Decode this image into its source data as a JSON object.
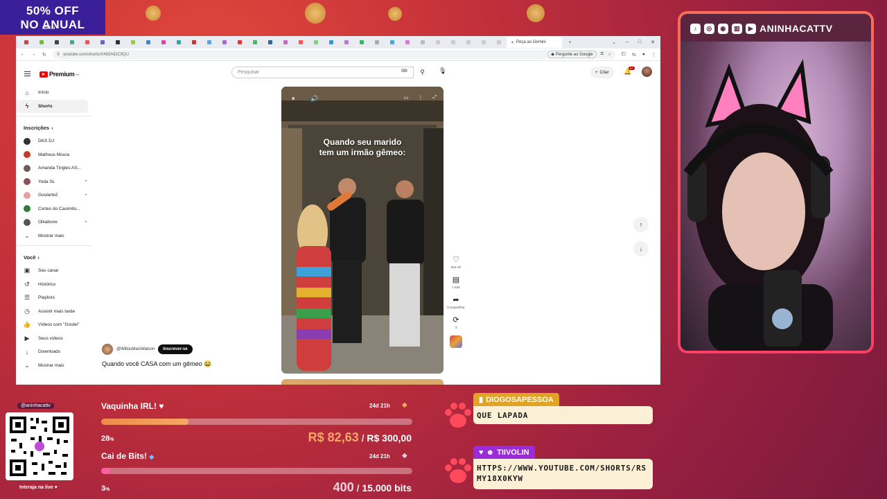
{
  "promo": {
    "line1": "50% OFF",
    "line2": "NO ANUAL",
    "line3": "EDIT.AI"
  },
  "browser": {
    "active_tab": "Peça ao Gemini",
    "url": "youtube.com/shorts/X4b5AtDC9QU",
    "gemini_label": "Pergunte ao Google"
  },
  "youtube": {
    "logo": "Premium",
    "logo_sup": "BR",
    "search_placeholder": "Pesquisar",
    "create_label": "Criar",
    "bell_badge": "9+",
    "sidebar": {
      "home": "Início",
      "shorts": "Shorts",
      "subs_header": "Inscrições",
      "channels": [
        {
          "name": "DKS DJ",
          "color": "#333333",
          "dot": false
        },
        {
          "name": "Matheus Moura",
          "color": "#c23b2b",
          "dot": false
        },
        {
          "name": "Amanda Tingles AS...",
          "color": "#6a5a58",
          "dot": false
        },
        {
          "name": "Yoda SL",
          "color": "#8a5060",
          "dot": true
        },
        {
          "name": "Goularte2",
          "color": "#e6a0a0",
          "dot": true
        },
        {
          "name": "Cortes do Casimito...",
          "color": "#2f7d3a",
          "dot": false
        },
        {
          "name": "Olkabone",
          "color": "#555555",
          "dot": true
        }
      ],
      "show_more_1": "Mostrar mais",
      "you_header": "Você",
      "you_items": [
        {
          "label": "Seu canal",
          "icon": "channel-icon",
          "glyph": "▣"
        },
        {
          "label": "Histórico",
          "icon": "history-icon",
          "glyph": "↺"
        },
        {
          "label": "Playlists",
          "icon": "playlist-icon",
          "glyph": "☰"
        },
        {
          "label": "Assistir mais tarde",
          "icon": "clock-icon",
          "glyph": "◷"
        },
        {
          "label": "Vídeos com \"Gostei\"",
          "icon": "thumbs-up-icon",
          "glyph": "👍"
        },
        {
          "label": "Seus vídeos",
          "icon": "video-icon",
          "glyph": "▶"
        },
        {
          "label": "Downloads",
          "icon": "download-icon",
          "glyph": "↓"
        }
      ],
      "show_more_2": "Mostrar mais"
    },
    "short": {
      "caption_line1": "Quando seu marido",
      "caption_line2": "tem um irmão gêmeo:",
      "channel": "@WillouMaisWatson",
      "subscribe": "Inscrever-se",
      "title": "Quando você CASA com um gêmeo 😂",
      "likes": "602 mil",
      "comments": "1.625",
      "share": "Compartilhar",
      "remix": "3"
    }
  },
  "stream": {
    "cam_name": "ANINHACATTV",
    "qr_handle": "@aninhacattv",
    "qr_caption": "Interaja na live ♥",
    "goal1": {
      "title": "Vaquinha IRL! ♥",
      "time": "24d 21h",
      "pct_label": "28",
      "pct": 0.28,
      "current": "R$ 82,63",
      "target": "R$ 300,00"
    },
    "goal2": {
      "title": "Cai de Bits!",
      "time": "24d 21h",
      "pct_label": "3",
      "pct": 0.03,
      "current": "400",
      "target": "15.000 bits"
    },
    "chat": [
      {
        "user": "DIOGOSAPESSOA",
        "message": "QUE LAPADA",
        "name_bg": "#e0a323"
      },
      {
        "user": "TIIVOLIN",
        "message": "HTTPS://WWW.YOUTUBE.COM/SHORTS/RSMY18X0KYW",
        "name_bg": "#9b2bd6"
      }
    ]
  }
}
